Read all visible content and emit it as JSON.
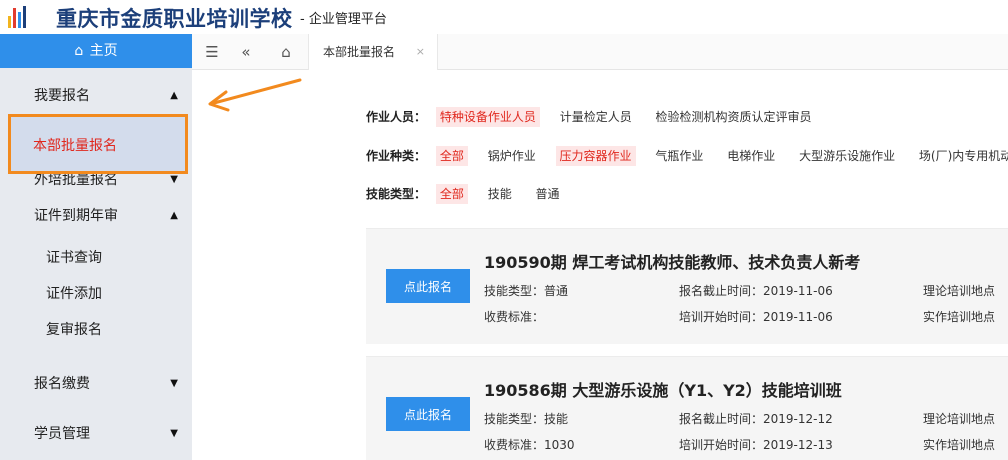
{
  "header": {
    "school_name": "重庆市金质职业培训学校",
    "platform_name": "- 企业管理平台"
  },
  "sidebar": {
    "home_label": "主页",
    "items": [
      {
        "label": "我要报名",
        "arrow": "▲"
      },
      {
        "label": "本部批量报名"
      },
      {
        "label": "外培批量报名",
        "arrow": "▼"
      },
      {
        "label": "证件到期年审",
        "arrow": "▲"
      },
      {
        "label": "证书查询"
      },
      {
        "label": "证件添加"
      },
      {
        "label": "复审报名"
      },
      {
        "label": "报名缴费",
        "arrow": "▼"
      },
      {
        "label": "学员管理",
        "arrow": "▼"
      }
    ]
  },
  "tabs": {
    "active_tab": "本部批量报名",
    "close": "×"
  },
  "filters": {
    "personnel": {
      "label": "作业人员：",
      "options": [
        "特种设备作业人员",
        "计量检定人员",
        "检验检测机构资质认定评审员"
      ],
      "selected": 0
    },
    "category": {
      "label": "作业种类：",
      "options": [
        "全部",
        "锅炉作业",
        "压力容器作业",
        "气瓶作业",
        "电梯作业",
        "大型游乐设施作业",
        "场(厂)内专用机动车"
      ],
      "selected": 0,
      "highlighted": 2
    },
    "skill": {
      "label": "技能类型：",
      "options": [
        "全部",
        "技能",
        "普通"
      ],
      "selected": 0
    }
  },
  "courses": [
    {
      "title": "190590期 焊工考试机构技能教师、技术负责人新考",
      "enroll_label": "点此报名",
      "skill_type": "技能类型：普通",
      "fee": "收费标准：",
      "deadline": "报名截止时间：2019-11-06",
      "start_date": "培训开始时间：2019-11-06",
      "theory_site": "理论培训地点",
      "practice_site": "实作培训地点"
    },
    {
      "title": "190586期 大型游乐设施（Y1、Y2）技能培训班",
      "enroll_label": "点此报名",
      "skill_type": "技能类型：技能",
      "fee": "收费标准：1030",
      "deadline": "报名截止时间：2019-12-12",
      "start_date": "培训开始时间：2019-12-13",
      "theory_site": "理论培训地点",
      "practice_site": "实作培训地点"
    }
  ],
  "colors": {
    "primary": "#2f8fea",
    "highlight_red": "#e0281e",
    "annotation_orange": "#f28a1e"
  }
}
